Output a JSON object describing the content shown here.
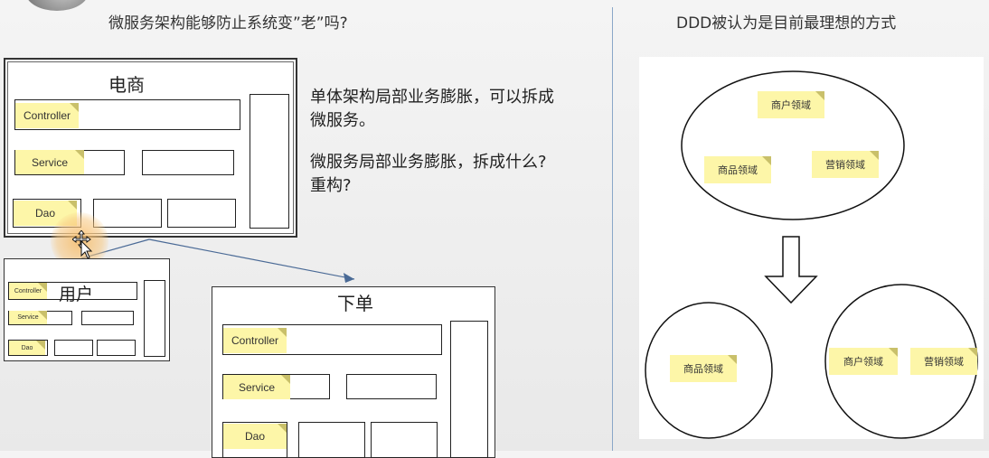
{
  "left": {
    "title": "微服务架构能够防止系统变”老”吗?",
    "ecommerce": {
      "title": "电商",
      "controller": "Controller",
      "service": "Service",
      "dao": "Dao"
    },
    "text": {
      "line1": "单体架构局部业务膨胀，可以拆成",
      "line2": "微服务。",
      "line3": "微服务局部业务膨胀，拆成什么?",
      "line4": "重构?"
    },
    "user": {
      "title": "用户",
      "controller": "Controller",
      "service": "Service",
      "dao": "Dao"
    },
    "order": {
      "title": "下单",
      "controller": "Controller",
      "service": "Service",
      "dao": "Dao"
    }
  },
  "right": {
    "title": "DDD被认为是目前最理想的方式",
    "top_circle": {
      "merchant": "商户领域",
      "product": "商品领域",
      "marketing": "营销领域"
    },
    "bottom_left": {
      "product": "商品领域"
    },
    "bottom_right": {
      "merchant": "商户领域",
      "marketing": "营销领域"
    }
  },
  "colors": {
    "sticky": "#fdf6a8",
    "divider": "#8aa7c8",
    "arrow_line": "#4a6a96"
  },
  "icons": {
    "cursor": "move-cursor-icon",
    "arrow_down": "arrow-down-icon"
  }
}
